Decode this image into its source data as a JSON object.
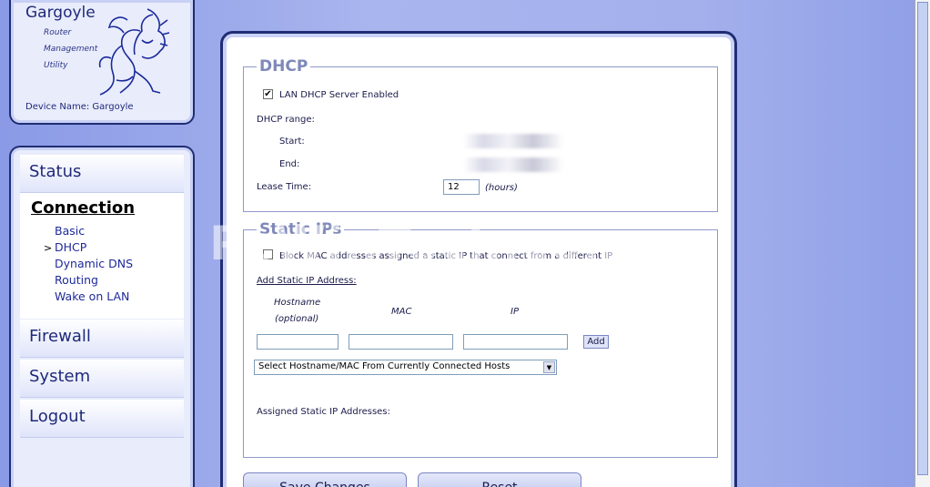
{
  "logo": {
    "title": "Gargoyle",
    "subtitle_lines": [
      "Router",
      "Management",
      "Utility"
    ],
    "device_name": "Device Name: Gargoyle"
  },
  "nav": {
    "status": "Status",
    "connection": "Connection",
    "sub_items": [
      {
        "label": "Basic",
        "selected": false
      },
      {
        "label": "DHCP",
        "selected": true
      },
      {
        "label": "Dynamic DNS",
        "selected": false
      },
      {
        "label": "Routing",
        "selected": false
      },
      {
        "label": "Wake on LAN",
        "selected": false
      }
    ],
    "selected_marker": ">",
    "firewall": "Firewall",
    "system": "System",
    "logout": "Logout"
  },
  "dhcp": {
    "legend": "DHCP",
    "server_enabled_label": "LAN DHCP Server Enabled",
    "server_enabled": true,
    "range_label": "DHCP range:",
    "start_label": "Start:",
    "end_label": "End:",
    "lease_label": "Lease Time:",
    "lease_value": "12",
    "lease_unit": "(hours)"
  },
  "static_ips": {
    "legend": "Static IPs",
    "block_mac_label": "Block MAC addresses assigned a static IP that connect from a different IP",
    "block_mac": false,
    "add_label": "Add Static IP Address:",
    "col_hostname": "Hostname",
    "col_optional": "(optional)",
    "col_mac": "MAC",
    "col_ip": "IP",
    "add_button": "Add",
    "select_value": "Select Hostname/MAC From Currently Connected Hosts",
    "assigned_label": "Assigned Static IP Addresses:"
  },
  "actions": {
    "save": "Save Changes",
    "reset": "Reset"
  },
  "watermark": "PcWinTech.com",
  "colors": {
    "background": "#8e9ee8",
    "panel_border": "#1f2d74",
    "nav_text": "#1f2a7a",
    "legend": "#7e89b9"
  }
}
